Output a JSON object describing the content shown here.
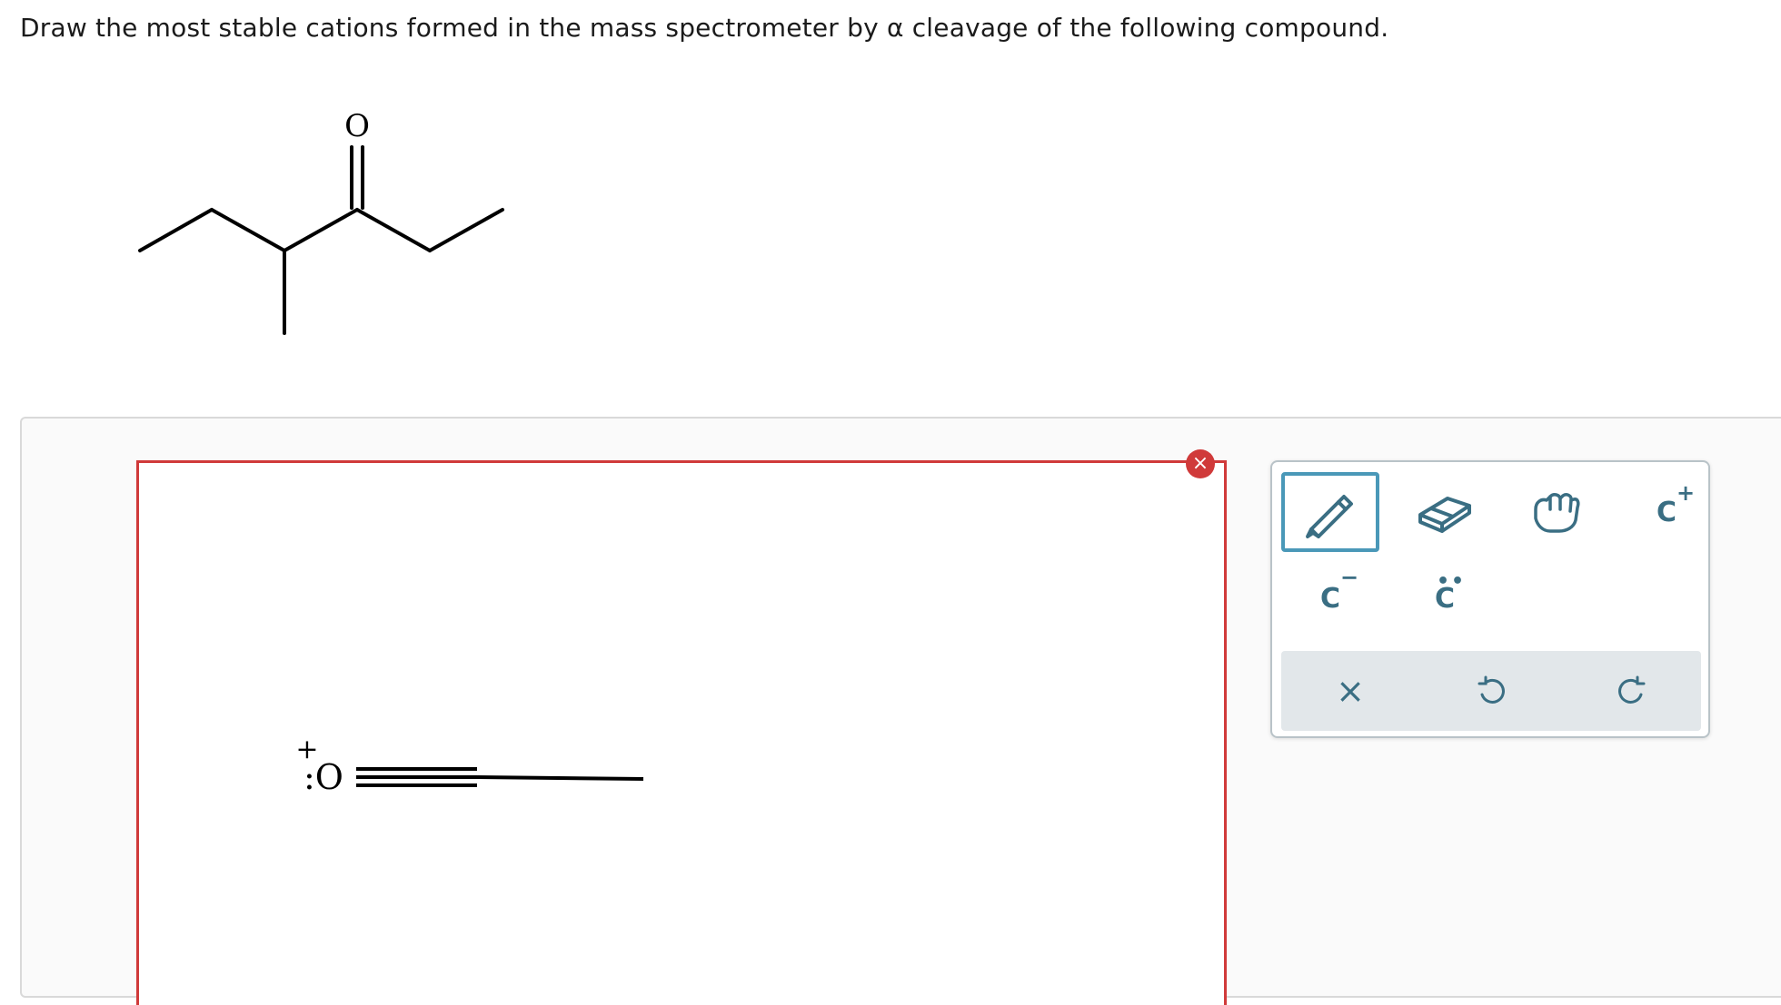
{
  "question": {
    "text": "Draw the most stable cations formed in the mass spectrometer by α cleavage of the following compound."
  },
  "compound": {
    "oxygen_label": "O"
  },
  "canvas": {
    "charge_label": "+",
    "oxygen_label": ":O",
    "close_icon": "×"
  },
  "toolbox": {
    "tools": [
      {
        "name": "pencil",
        "icon": "pencil-icon",
        "active": true
      },
      {
        "name": "eraser",
        "icon": "eraser-icon"
      },
      {
        "name": "hand",
        "icon": "hand-icon"
      },
      {
        "name": "add-cation",
        "icon": "carbocation-icon",
        "label": "C",
        "charge": "+"
      },
      {
        "name": "add-anion",
        "icon": "carbanion-icon",
        "label": "C",
        "charge": "−"
      },
      {
        "name": "add-lone-pair",
        "icon": "lone-pair-icon",
        "label": "C"
      }
    ],
    "actions": {
      "clear": "×",
      "undo": "undo-icon",
      "redo": "redo-icon"
    },
    "colors": {
      "accent": "#4a98b8",
      "icon": "#3a6e83",
      "error": "#d03a3a"
    }
  }
}
